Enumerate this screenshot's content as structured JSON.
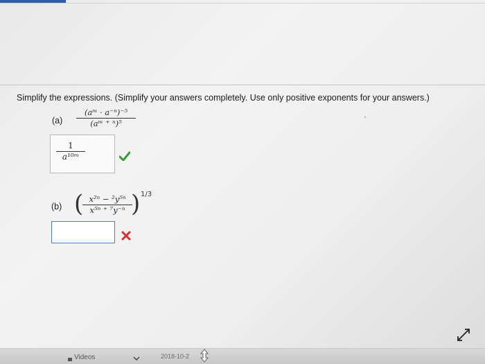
{
  "instructions": "Simplify the expressions. (Simplify your answers completely. Use only positive exponents for your answers.)",
  "part_a": {
    "label": "(a)",
    "numerator": "(aᵐ · a⁻ⁿ)⁻⁵",
    "denominator": "(aᵐ ⁺ ⁿ)⁵",
    "answer_numerator": "1",
    "answer_denominator": "a¹⁰ᵐ",
    "status": "correct"
  },
  "part_b": {
    "label": "(b)",
    "numerator": "x²ⁿ − ²y⁵ⁿ",
    "denominator": "x⁵ⁿ ⁺ ⁷y⁻ⁿ",
    "power": "1/3",
    "answer_value": "",
    "status": "incorrect"
  },
  "footer": {
    "video_label": "Videos",
    "date_text": "2018-10-2"
  },
  "colors": {
    "correct": "#3a9a3a",
    "incorrect": "#d03030",
    "accent": "#2d5fa8"
  }
}
